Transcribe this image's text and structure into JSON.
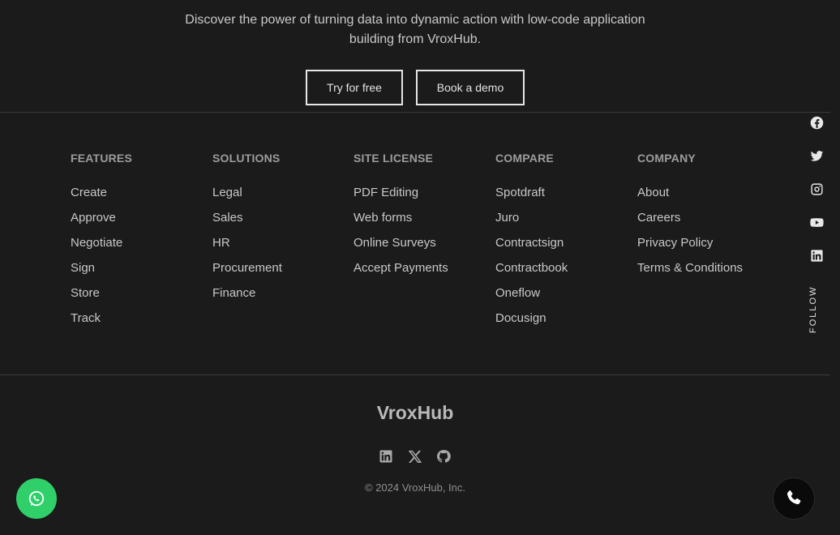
{
  "hero": {
    "tagline": "Discover the power of turning data into dynamic action with low-code application building from VroxHub.",
    "try_label": "Try for free",
    "demo_label": "Book a demo"
  },
  "columns": [
    {
      "title": "FEATURES",
      "items": [
        "Create",
        "Approve",
        "Negotiate",
        "Sign",
        "Store",
        "Track"
      ]
    },
    {
      "title": "SOLUTIONS",
      "items": [
        "Legal",
        "Sales",
        "HR",
        "Procurement",
        "Finance"
      ]
    },
    {
      "title": "SITE LICENSE",
      "items": [
        "PDF Editing",
        "Web forms",
        "Online Surveys",
        "Accept Payments"
      ]
    },
    {
      "title": "COMPARE",
      "items": [
        "Spotdraft",
        "Juro",
        "Contractsign",
        "Contractbook",
        "Oneflow",
        "Docusign"
      ]
    },
    {
      "title": "COMPANY",
      "items": [
        "About",
        "Careers",
        "Privacy Policy",
        "Terms & Conditions"
      ]
    }
  ],
  "social_rail": {
    "icons": [
      "facebook-icon",
      "twitter-icon",
      "instagram-icon",
      "youtube-icon",
      "linkedin-icon"
    ],
    "follow_label": "FOLLOW"
  },
  "footer": {
    "brand": "VroxHub",
    "icons": [
      "linkedin-icon",
      "x-icon",
      "github-icon"
    ],
    "copyright": "© 2024 VroxHub, Inc."
  },
  "colors": {
    "background": "#1b1b1b",
    "whatsapp": "#2fd06a",
    "phone": "#0a0a0a"
  }
}
